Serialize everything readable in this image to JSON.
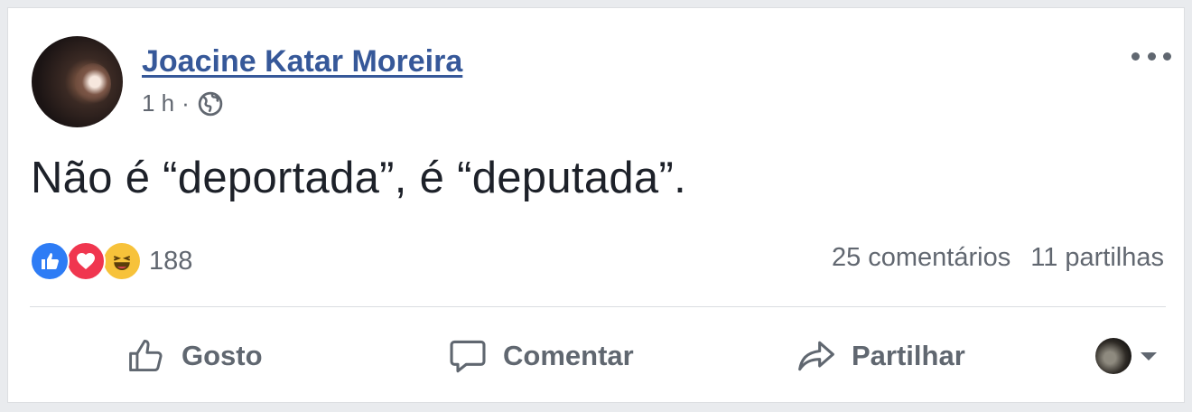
{
  "post": {
    "author": "Joacine Katar Moreira",
    "time": "1 h",
    "separator": "·",
    "privacy_icon": "globe-icon",
    "text": "Não é “deportada”, é “deputada”."
  },
  "reactions": {
    "icons": [
      "like-icon",
      "love-icon",
      "haha-icon"
    ],
    "count": "188"
  },
  "stats": {
    "comments": "25 comentários",
    "shares": "11 partilhas"
  },
  "actions": {
    "like_label": "Gosto",
    "comment_label": "Comentar",
    "share_label": "Partilhar"
  },
  "colors": {
    "author_link": "#365899",
    "meta_text": "#616770",
    "like_blue": "#2e7cf5",
    "love_red": "#f0364f",
    "haha_yellow": "#f7c23a"
  }
}
